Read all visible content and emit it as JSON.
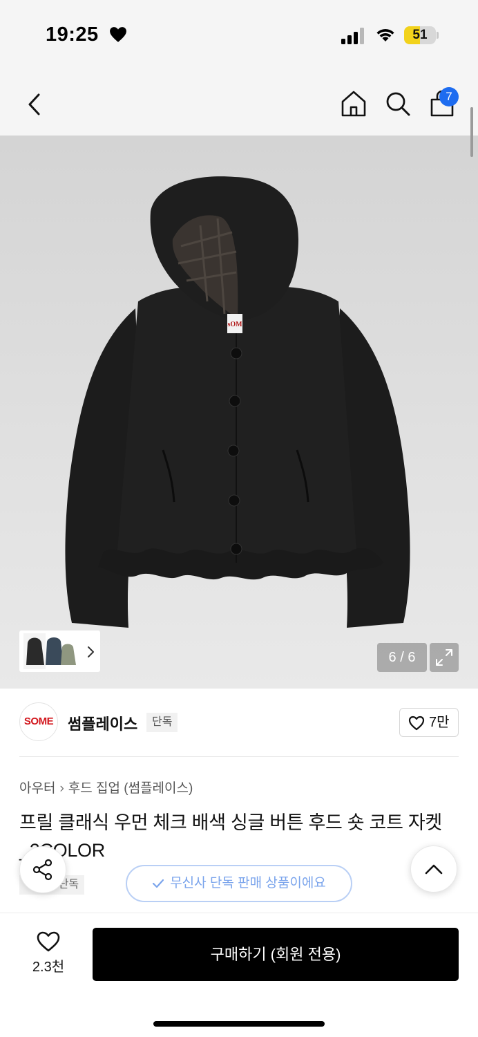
{
  "status_bar": {
    "time": "19:25",
    "battery": "51",
    "battery_color": "#f2d21b"
  },
  "header": {
    "back_icon": "chevron-left-icon",
    "home_icon": "home-icon",
    "search_icon": "search-icon",
    "cart_icon": "shopping-bag-icon",
    "cart_count": "7",
    "badge_color": "#1d6cf0"
  },
  "gallery": {
    "counter": "6 / 6",
    "current": 6,
    "total": 6,
    "expand_icon": "expand-icon"
  },
  "brand": {
    "logo_text": "SOME",
    "logo_color": "#d2161c",
    "name": "썸플레이스",
    "tag": "단독",
    "likes": "7만"
  },
  "product": {
    "breadcrumb": [
      "아우터",
      "후드 집업 (썸플레이스)"
    ],
    "title": "프릴 클래식 우먼 체크 배색 싱글 버튼 후드 숏 코트 자켓_2COLOR",
    "sub_tag": "무신사 단독",
    "exclusive_notice": "무신사 단독 판매 상품이에요"
  },
  "bottom_bar": {
    "wish_count": "2.3천",
    "buy_label": "구매하기 (회원 전용)"
  }
}
